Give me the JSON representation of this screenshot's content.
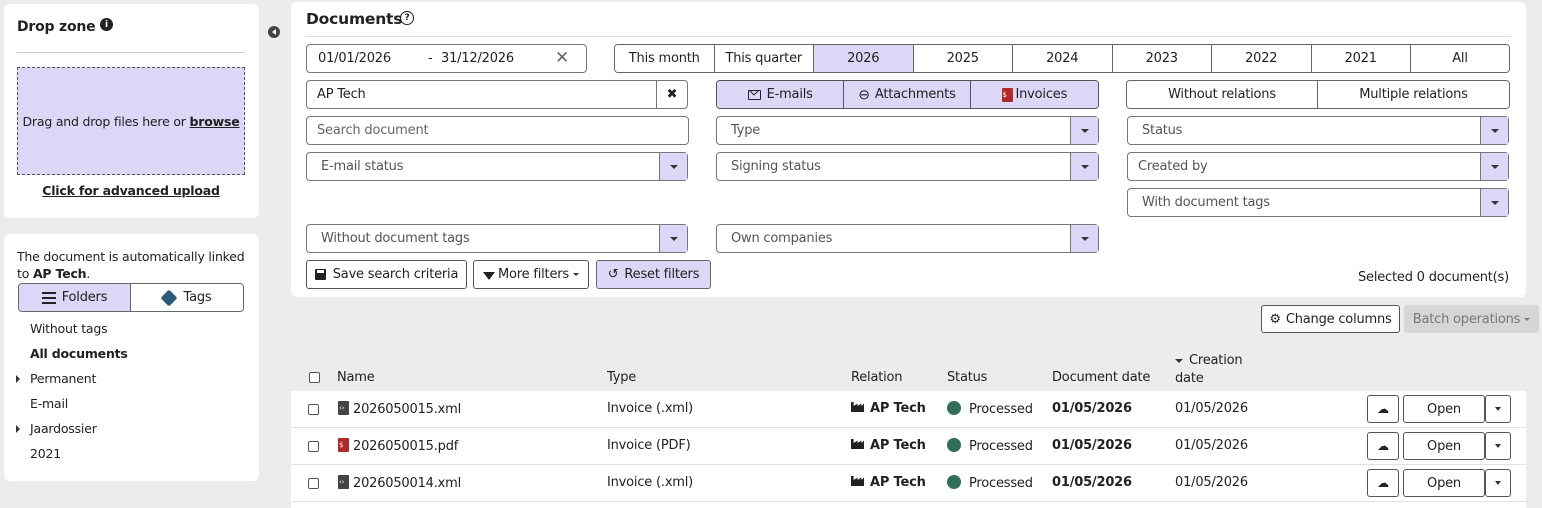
{
  "dropzone": {
    "title": "Drop zone",
    "drag_text": "Drag and drop files here or ",
    "browse_link": "browse",
    "advanced_upload": "Click for advanced upload"
  },
  "link_info": {
    "text_prefix": "The document is automatically linked to ",
    "company": "AP Tech",
    "suffix": ".",
    "view_tabs": [
      "Folders",
      "Tags"
    ],
    "folders": [
      "Without tags",
      "All documents",
      "Permanent",
      "E-mail",
      "Jaardossier",
      "2021"
    ]
  },
  "header": {
    "title": "Documents"
  },
  "filters": {
    "date_from": "01/01/2026",
    "date_sep": "-",
    "date_to": "31/12/2026",
    "periods": [
      "This month",
      "This quarter",
      "2026",
      "2025",
      "2024",
      "2023",
      "2022",
      "2021",
      "All"
    ],
    "company_value": "AP Tech",
    "doc_kinds": [
      "E-mails",
      "Attachments",
      "Invoices"
    ],
    "relation_kinds": [
      "Without relations",
      "Multiple relations"
    ],
    "search_placeholder": "Search document",
    "type_placeholder": "Type",
    "status_placeholder": "Status",
    "email_status_placeholder": "E-mail status",
    "signing_status_placeholder": "Signing status",
    "created_by_placeholder": "Created by",
    "with_tags_placeholder": "With document tags",
    "without_tags_placeholder": "Without document tags",
    "own_companies_placeholder": "Own companies",
    "save_search": "Save search criteria",
    "more_filters": "More filters",
    "reset_filters": "Reset filters",
    "selected_count": "Selected 0 document(s)"
  },
  "toolbar": {
    "change_columns": "Change columns",
    "batch_operations": "Batch operations"
  },
  "table": {
    "columns": {
      "name": "Name",
      "type": "Type",
      "relation": "Relation",
      "status": "Status",
      "document_date": "Document date",
      "creation_date_1": "Creation",
      "creation_date_2": "date"
    },
    "open_label": "Open",
    "rows": [
      {
        "name": "2026050015.xml",
        "file_kind": "xml",
        "type": "Invoice (.xml)",
        "relation": "AP Tech",
        "status": "Processed",
        "document_date": "01/05/2026",
        "creation_date": "01/05/2026"
      },
      {
        "name": "2026050015.pdf",
        "file_kind": "pdf",
        "type": "Invoice (PDF)",
        "relation": "AP Tech",
        "status": "Processed",
        "document_date": "01/05/2026",
        "creation_date": "01/05/2026"
      },
      {
        "name": "2026050014.xml",
        "file_kind": "xml",
        "type": "Invoice (.xml)",
        "relation": "AP Tech",
        "status": "Processed",
        "document_date": "01/05/2026",
        "creation_date": "01/05/2026"
      }
    ]
  },
  "colors": {
    "accent": "#dcd6f7",
    "status_processed": "#2e6e5a",
    "invoice_icon": "#b02a2a"
  }
}
